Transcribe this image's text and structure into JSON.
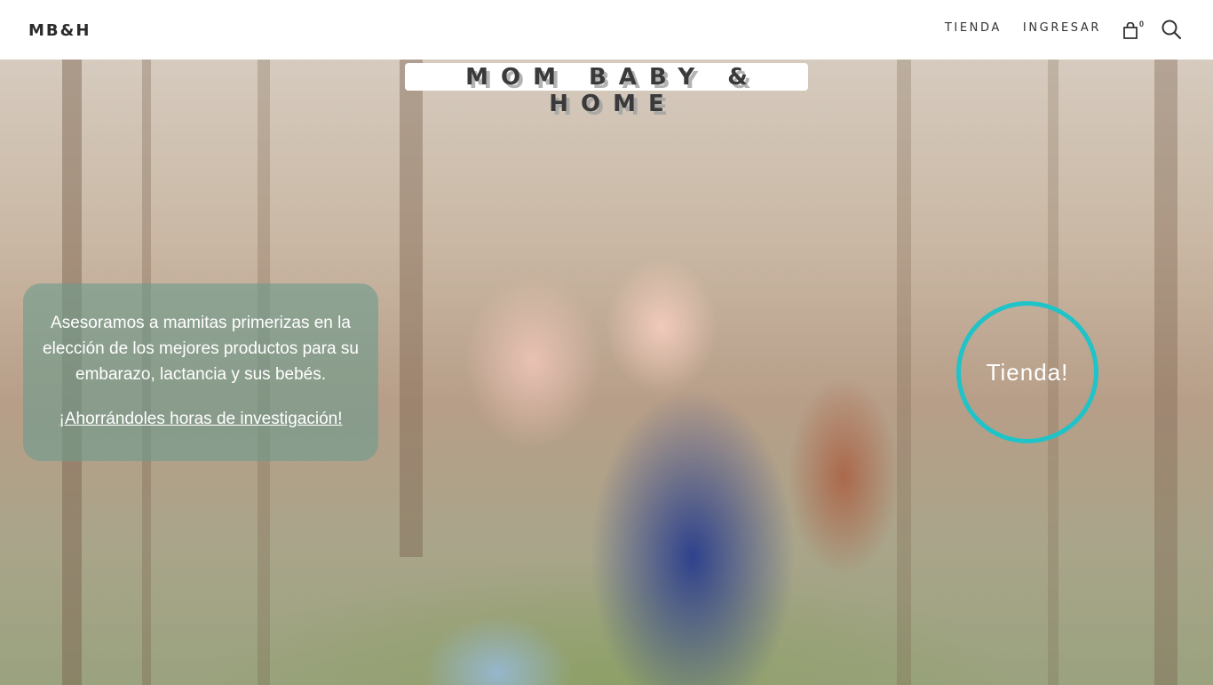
{
  "header": {
    "logo": "MB&H",
    "nav": {
      "shop": "TIENDA",
      "login": "INGRESAR"
    },
    "cart_count": "0",
    "icons": {
      "cart": "shopping-bag-icon",
      "search": "search-icon"
    }
  },
  "hero": {
    "title": "MOM BABY & HOME",
    "description": "Asesoramos a mamitas primerizas en la elección de los mejores productos para su embarazo, lactancia y sus bebés.",
    "link": "¡Ahorrándoles horas de investigación!",
    "cta": "Tienda!"
  },
  "colors": {
    "accent_circle": "#1fc3c8",
    "info_box": "#6e9b8c",
    "text_dark": "#333333"
  }
}
